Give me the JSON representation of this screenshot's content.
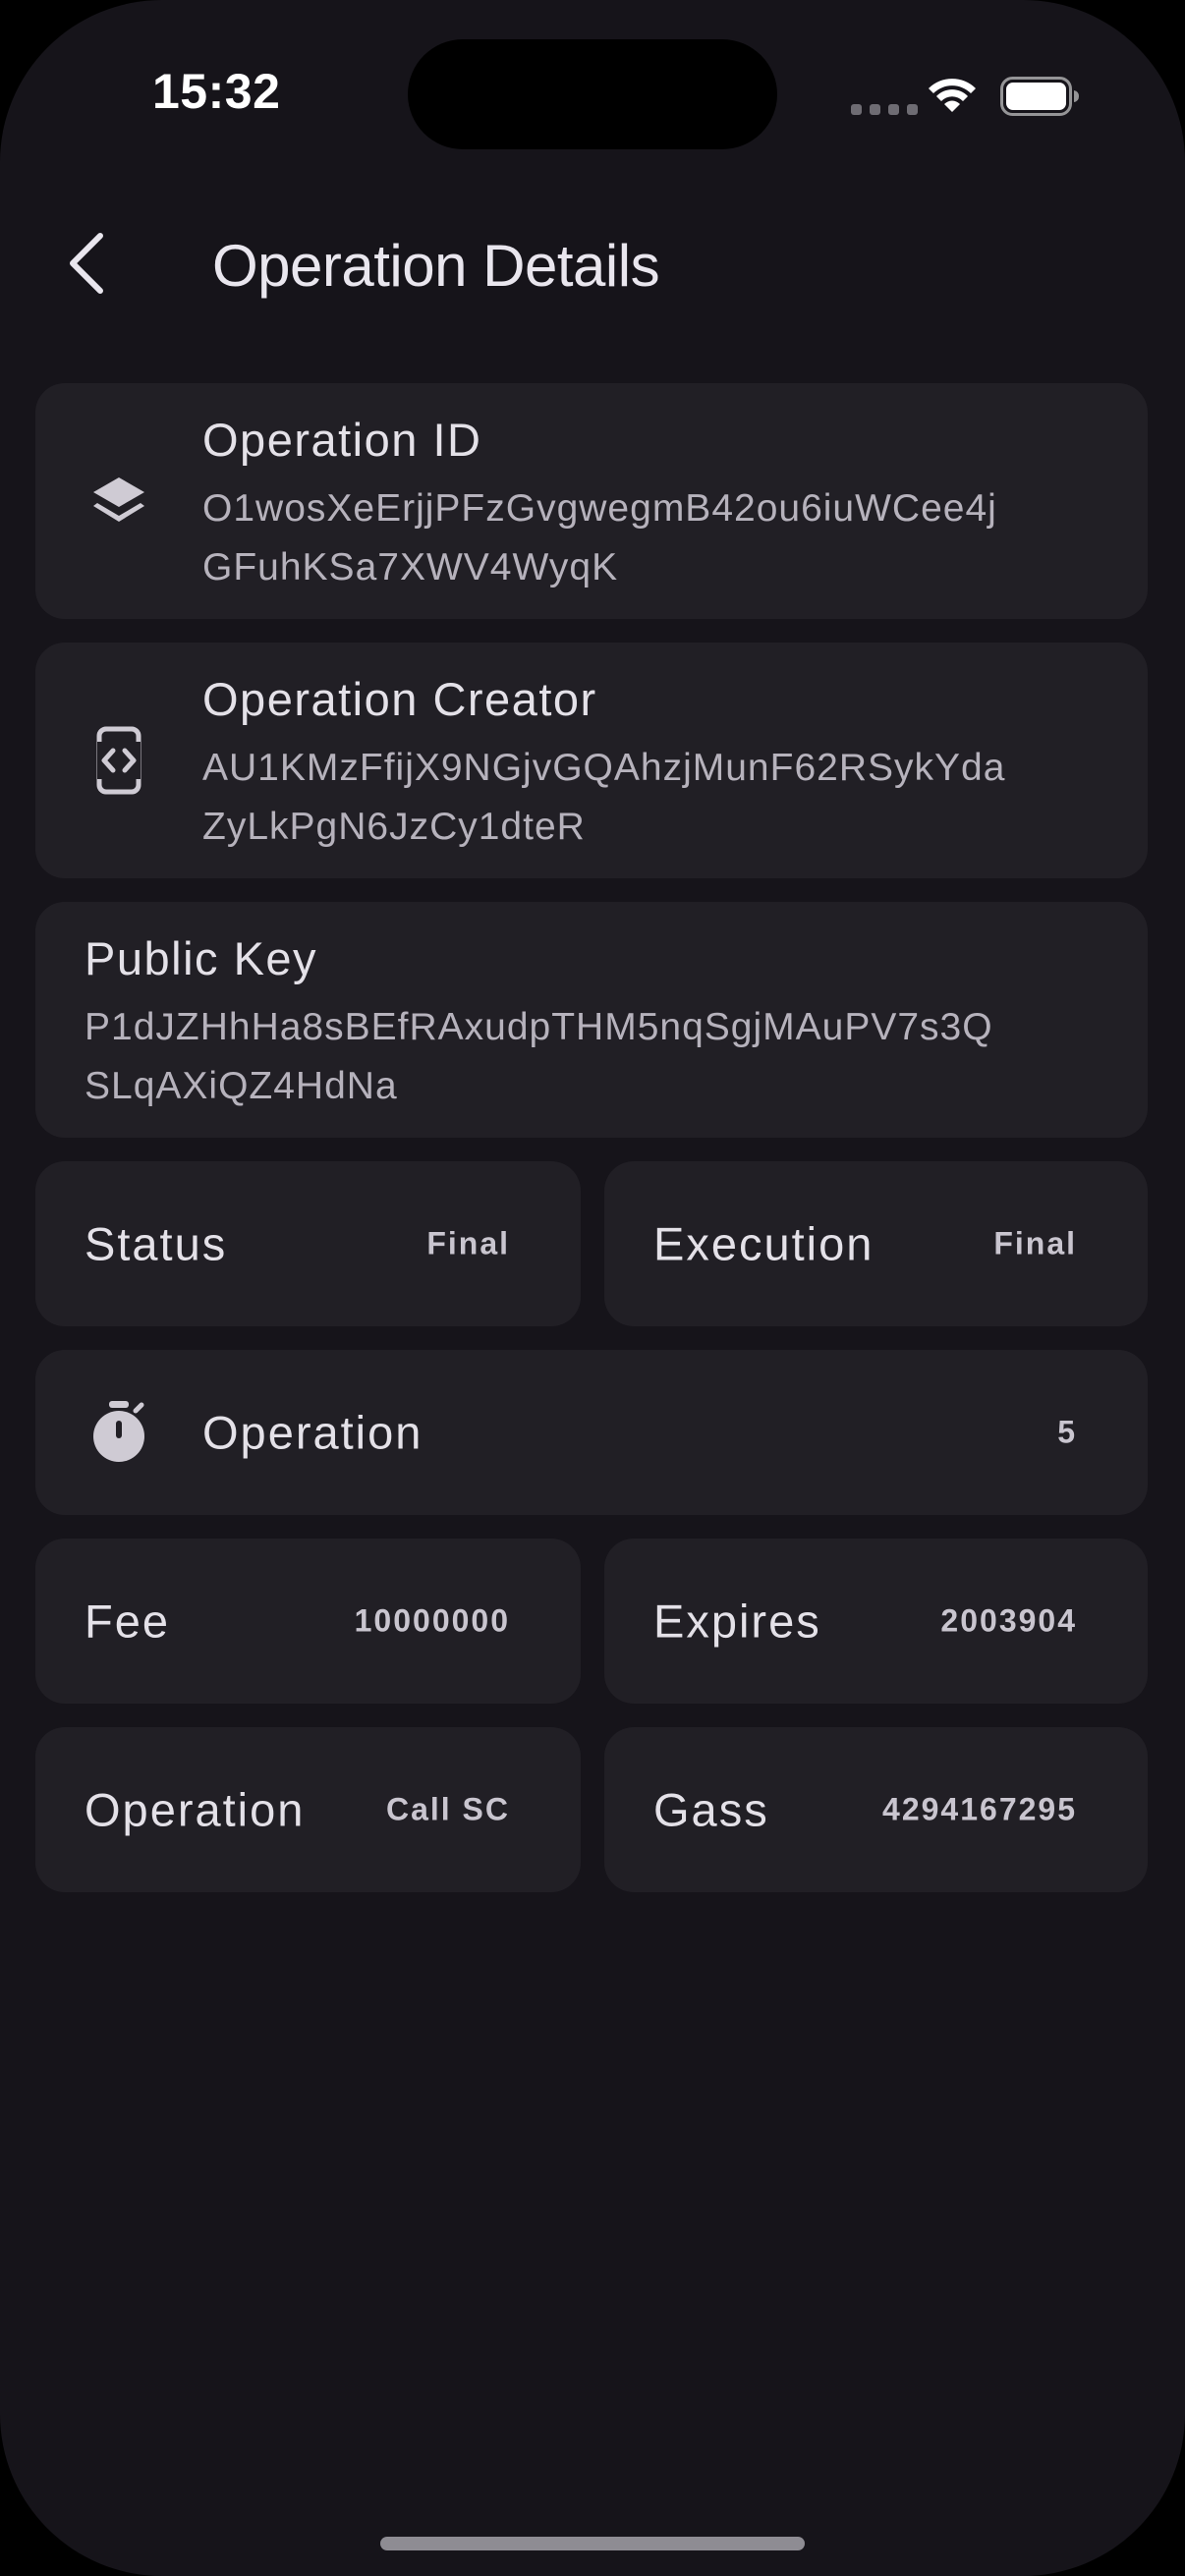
{
  "status_bar": {
    "time": "15:32"
  },
  "header": {
    "back_icon": "chevron-left-icon",
    "title": "Operation Details"
  },
  "operation_id": {
    "icon": "layers-icon",
    "label": "Operation ID",
    "value_line1": "O1wosXeErjjPFzGvgwegmB42ou6iuWCee4j",
    "value_line2": "GFuhKSa7XWV4WyqK"
  },
  "operation_creator": {
    "icon": "code-device-icon",
    "label": "Operation Creator",
    "value_line1": "AU1KMzFfijX9NGjvGQAhzjMunF62RSykYda",
    "value_line2": "ZyLkPgN6JzCy1dteR"
  },
  "public_key": {
    "label": "Public Key",
    "value_line1": "P1dJZHhHa8sBEfRAxudpTHM5nqSgjMAuPV7s3Q",
    "value_line2": "SLqAXiQZ4HdNa"
  },
  "status": {
    "label": "Status",
    "value": "Final"
  },
  "execution": {
    "label": "Execution",
    "value": "Final"
  },
  "operation_timer": {
    "icon": "timer-icon",
    "label": "Operation",
    "value": "5"
  },
  "fee": {
    "label": "Fee",
    "value": "10000000"
  },
  "expires": {
    "label": "Expires",
    "value": "2003904"
  },
  "operation_type": {
    "label": "Operation",
    "value": "Call SC"
  },
  "gas": {
    "label": "Gass",
    "value": "4294167295"
  },
  "colors": {
    "background": "#16141a",
    "card": "#211f25",
    "text_primary": "#e4e1e8",
    "text_secondary": "#b6b2bc"
  }
}
